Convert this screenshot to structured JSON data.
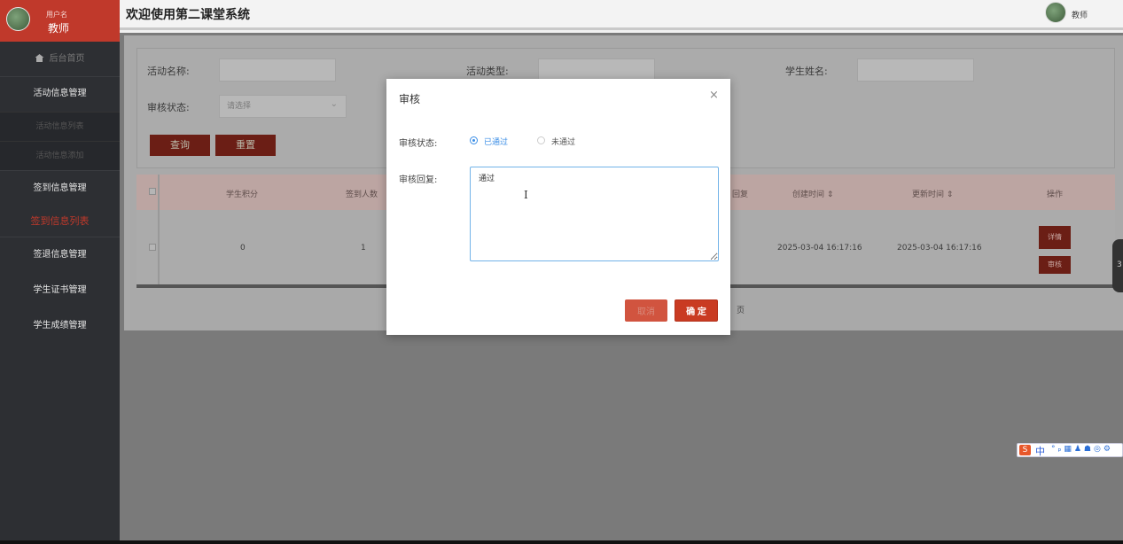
{
  "sidebar": {
    "user_label": "用户名",
    "user_role": "教师",
    "home": "后台首页",
    "items": [
      {
        "label": "活动信息管理"
      },
      {
        "label": "活动信息列表"
      },
      {
        "label": "活动信息添加"
      },
      {
        "label": "签到信息管理"
      },
      {
        "label": "签到信息列表"
      },
      {
        "label": "签退信息管理"
      },
      {
        "label": "学生证书管理"
      },
      {
        "label": "学生成绩管理"
      }
    ]
  },
  "header": {
    "title": "欢迎使用第二课堂系统",
    "user": "教师"
  },
  "search": {
    "activity_name_label": "活动名称:",
    "activity_type_label": "活动类型:",
    "student_name_label": "学生姓名:",
    "status_label": "审核状态:",
    "status_placeholder": "请选择",
    "query_button": "查询",
    "reset_button": "重置"
  },
  "table": {
    "headers": [
      "学生积分",
      "签到人数",
      "回复",
      "创建时间 ⇕",
      "更新时间 ⇕",
      "操作"
    ],
    "row": {
      "points": "0",
      "signin_count": "1",
      "created": "2025-03-04 16:17:16",
      "updated": "2025-03-04 16:17:16",
      "detail_button": "详情",
      "review_button": "审核"
    },
    "pager_suffix": "页"
  },
  "modal": {
    "title": "审核",
    "close": "×",
    "status_label": "审核状态:",
    "option_pass": "已通过",
    "option_fail": "未通过",
    "selected": "已通过",
    "reply_label": "审核回复:",
    "reply_value": "通过",
    "cancel_button": "取消",
    "ok_button": "确 定"
  },
  "side_tab": "3",
  "ime": {
    "logo": "S",
    "mode": "中",
    "tools": "°ₚ▦♟☗◎⚙"
  },
  "colors": {
    "accent": "#c93b22",
    "sidebar_bg": "#2d2f33",
    "radio_blue": "#3b8ee6"
  }
}
